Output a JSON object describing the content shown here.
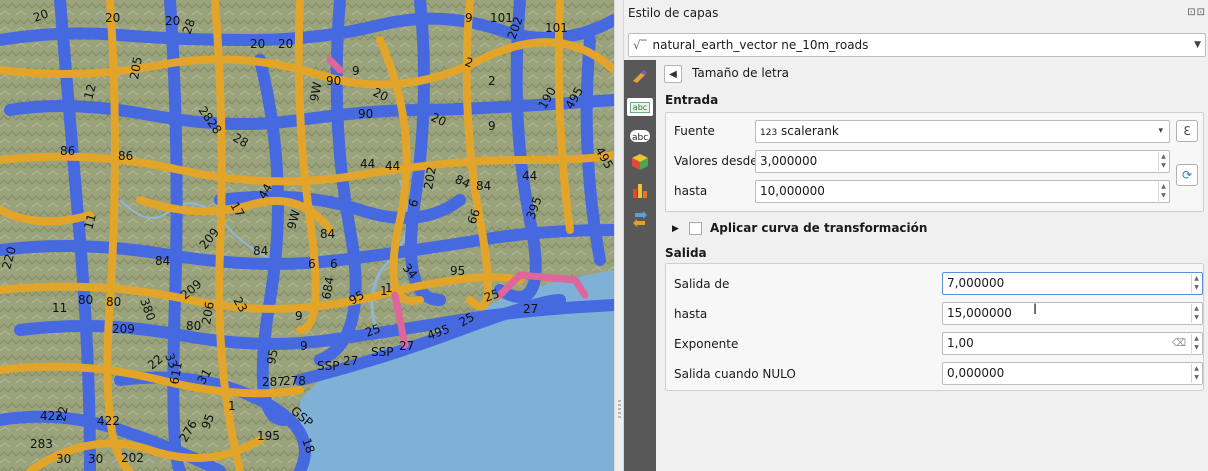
{
  "panel": {
    "title": "Estilo de capas",
    "title_controls": "⊡⊡",
    "layer_prefix": "√‾",
    "layer_name": "natural_earth_vector ne_10m_roads",
    "breadcrumb": "Tamaño de letra",
    "label_tab_text": "abc"
  },
  "entrada": {
    "title": "Entrada",
    "fuente_label": "Fuente",
    "fuente_type": "123",
    "fuente_value": "scalerank",
    "valores_desde_label": "Valores desde",
    "valores_desde_value": "3,000000",
    "hasta_label": "hasta",
    "hasta_value": "10,000000"
  },
  "curve": {
    "label": "Aplicar curva de transformación",
    "checked": false
  },
  "salida": {
    "title": "Salida",
    "salida_de_label": "Salida de",
    "salida_de_value": "7,000000",
    "hasta_label": "hasta",
    "hasta_value": "15,000000",
    "exponente_label": "Exponente",
    "exponente_value": "1,00",
    "nulo_label": "Salida cuando NULO",
    "nulo_value": "0,000000"
  },
  "map": {
    "colors": {
      "terrain": "#9aa37c",
      "sea": "#7fb0d6",
      "road_blue": "#4669e0",
      "road_orange": "#e2a529",
      "road_pink": "#e0659b"
    },
    "labels": [
      {
        "t": "20"
      },
      {
        "t": "20"
      },
      {
        "t": "20"
      },
      {
        "t": "28"
      },
      {
        "t": "20"
      },
      {
        "t": "20"
      },
      {
        "t": "9"
      },
      {
        "t": "101"
      },
      {
        "t": "101"
      },
      {
        "t": "202"
      },
      {
        "t": "205"
      },
      {
        "t": "12"
      },
      {
        "t": "86"
      },
      {
        "t": "86"
      },
      {
        "t": "28"
      },
      {
        "t": "2828"
      },
      {
        "t": "90"
      },
      {
        "t": "9W"
      },
      {
        "t": "9"
      },
      {
        "t": "20"
      },
      {
        "t": "20"
      },
      {
        "t": "2"
      },
      {
        "t": "2"
      },
      {
        "t": "190"
      },
      {
        "t": "495"
      },
      {
        "t": "9"
      },
      {
        "t": "90"
      },
      {
        "t": "44"
      },
      {
        "t": "44"
      },
      {
        "t": "44"
      },
      {
        "t": "202"
      },
      {
        "t": "84"
      },
      {
        "t": "84"
      },
      {
        "t": "44"
      },
      {
        "t": "6"
      },
      {
        "t": "66"
      },
      {
        "t": "395"
      },
      {
        "t": "495"
      },
      {
        "t": "11"
      },
      {
        "t": "17"
      },
      {
        "t": "209"
      },
      {
        "t": "84"
      },
      {
        "t": "9W"
      },
      {
        "t": "84"
      },
      {
        "t": "6"
      },
      {
        "t": "6"
      },
      {
        "t": "34"
      },
      {
        "t": "95"
      },
      {
        "t": "1"
      },
      {
        "t": "220"
      },
      {
        "t": "84"
      },
      {
        "t": "380"
      },
      {
        "t": "209"
      },
      {
        "t": "206"
      },
      {
        "t": "23"
      },
      {
        "t": "684"
      },
      {
        "t": "95"
      },
      {
        "t": "1"
      },
      {
        "t": "25"
      },
      {
        "t": "25"
      },
      {
        "t": "25"
      },
      {
        "t": "27"
      },
      {
        "t": "11"
      },
      {
        "t": "80"
      },
      {
        "t": "80"
      },
      {
        "t": "209"
      },
      {
        "t": "80"
      },
      {
        "t": "9"
      },
      {
        "t": "9"
      },
      {
        "t": "SSP"
      },
      {
        "t": "27"
      },
      {
        "t": "SSP"
      },
      {
        "t": "27"
      },
      {
        "t": "495"
      },
      {
        "t": "22"
      },
      {
        "t": "611"
      },
      {
        "t": "31"
      },
      {
        "t": "33"
      },
      {
        "t": "95"
      },
      {
        "t": "278"
      },
      {
        "t": "422"
      },
      {
        "t": "422"
      },
      {
        "t": "22"
      },
      {
        "t": "195"
      },
      {
        "t": "GSP"
      },
      {
        "t": "18"
      },
      {
        "t": "283"
      },
      {
        "t": "30"
      },
      {
        "t": "30"
      },
      {
        "t": "202"
      },
      {
        "t": "276"
      },
      {
        "t": "287"
      },
      {
        "t": "95"
      },
      {
        "t": "1"
      }
    ]
  }
}
